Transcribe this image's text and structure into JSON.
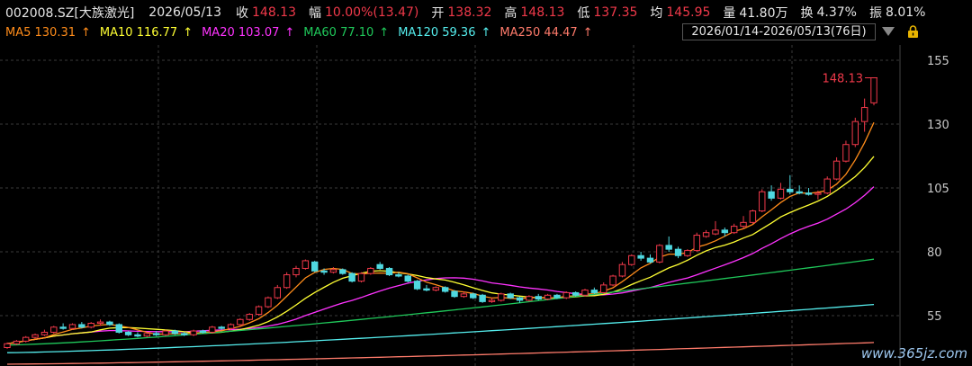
{
  "header": {
    "code": "002008.SZ[大族激光]",
    "date": "2026/05/13",
    "close_label": "收",
    "close": "148.13",
    "change_label": "幅",
    "change": "10.00%(13.47)",
    "open_label": "开",
    "open": "138.32",
    "high_label": "高",
    "high": "148.13",
    "low_label": "低",
    "low": "137.35",
    "avg_label": "均",
    "avg": "145.95",
    "volume_label": "量",
    "volume": "41.80万",
    "turnover_label": "换",
    "turnover": "4.37%",
    "amplitude_label": "振",
    "amplitude": "8.01%"
  },
  "ma_legend": [
    {
      "label": "MA5 130.31",
      "arrow": "↑",
      "color": "#ff8c1a"
    },
    {
      "label": "MA10 116.77",
      "arrow": "↑",
      "color": "#ffff33"
    },
    {
      "label": "MA20 103.07",
      "arrow": "↑",
      "color": "#ff33ff"
    },
    {
      "label": "MA60 77.10",
      "arrow": "↑",
      "color": "#1fc85a"
    },
    {
      "label": "MA120 59.36",
      "arrow": "↑",
      "color": "#55eeee"
    },
    {
      "label": "MA250 44.47",
      "arrow": "↑",
      "color": "#ff7b6b"
    }
  ],
  "range_label": "2026/01/14-2026/05/13(76日)",
  "watermark": "www.365jz.com",
  "colors": {
    "up": "#f0394a",
    "down": "#4fd8e0",
    "grid": "#3a3a3a"
  },
  "icons": [
    "dropdown-triangle-icon",
    "lock-icon"
  ],
  "chart_data": {
    "type": "candlestick",
    "yticks": [
      55,
      80,
      105,
      130,
      155
    ],
    "ylim": [
      45,
      160
    ],
    "last_price_label": "148.13",
    "candles": [
      [
        42.5,
        44.0,
        42.0,
        44.5
      ],
      [
        44.0,
        45.0,
        43.5,
        45.5
      ],
      [
        45.0,
        46.5,
        44.5,
        47.0
      ],
      [
        46.5,
        47.5,
        46.0,
        48.0
      ],
      [
        47.5,
        48.5,
        47.0,
        49.5
      ],
      [
        48.5,
        50.5,
        48.0,
        51.0
      ],
      [
        50.5,
        50.0,
        49.5,
        52.0
      ],
      [
        50.0,
        51.5,
        49.5,
        52.0
      ],
      [
        51.5,
        50.5,
        50.0,
        52.5
      ],
      [
        50.5,
        52.0,
        50.0,
        52.5
      ],
      [
        52.0,
        52.5,
        51.0,
        53.5
      ],
      [
        52.5,
        51.5,
        51.0,
        53.0
      ],
      [
        51.5,
        48.5,
        48.0,
        52.0
      ],
      [
        48.5,
        47.5,
        47.0,
        49.0
      ],
      [
        47.5,
        47.0,
        46.5,
        48.5
      ],
      [
        47.0,
        48.0,
        46.5,
        48.5
      ],
      [
        48.0,
        47.5,
        47.0,
        49.0
      ],
      [
        47.5,
        49.0,
        47.0,
        49.5
      ],
      [
        49.0,
        48.0,
        47.5,
        49.5
      ],
      [
        48.0,
        47.5,
        47.0,
        48.5
      ],
      [
        47.5,
        49.0,
        47.0,
        49.5
      ],
      [
        49.0,
        48.5,
        48.0,
        49.5
      ],
      [
        48.5,
        50.5,
        48.0,
        51.0
      ],
      [
        50.5,
        50.0,
        49.5,
        51.0
      ],
      [
        50.0,
        51.5,
        49.5,
        52.0
      ],
      [
        51.5,
        53.5,
        51.0,
        54.0
      ],
      [
        53.5,
        55.5,
        53.0,
        56.0
      ],
      [
        55.5,
        58.5,
        55.0,
        59.0
      ],
      [
        58.5,
        62.0,
        58.0,
        62.5
      ],
      [
        62.0,
        66.0,
        61.5,
        67.0
      ],
      [
        66.0,
        71.0,
        65.5,
        72.0
      ],
      [
        71.0,
        73.5,
        70.0,
        74.5
      ],
      [
        73.5,
        76.5,
        73.0,
        77.0
      ],
      [
        76.0,
        72.5,
        72.0,
        76.5
      ],
      [
        72.5,
        72.0,
        71.0,
        73.5
      ],
      [
        72.0,
        73.0,
        71.5,
        74.0
      ],
      [
        73.0,
        71.5,
        71.0,
        73.5
      ],
      [
        71.5,
        68.5,
        68.0,
        72.0
      ],
      [
        68.5,
        71.5,
        68.0,
        72.0
      ],
      [
        71.5,
        73.5,
        71.0,
        74.0
      ],
      [
        75.0,
        73.5,
        73.0,
        76.0
      ],
      [
        73.5,
        71.0,
        70.5,
        74.0
      ],
      [
        71.0,
        70.5,
        70.0,
        72.0
      ],
      [
        70.5,
        68.5,
        68.0,
        71.0
      ],
      [
        68.5,
        65.5,
        65.0,
        69.0
      ],
      [
        65.5,
        65.0,
        64.5,
        67.0
      ],
      [
        65.0,
        66.0,
        64.5,
        66.5
      ],
      [
        66.0,
        64.5,
        64.0,
        66.5
      ],
      [
        64.5,
        62.5,
        62.0,
        65.0
      ],
      [
        62.5,
        63.5,
        62.0,
        64.5
      ],
      [
        63.5,
        62.0,
        61.5,
        64.0
      ],
      [
        63.0,
        60.5,
        60.0,
        63.5
      ],
      [
        60.5,
        61.0,
        60.0,
        62.0
      ],
      [
        61.0,
        63.5,
        60.5,
        64.0
      ],
      [
        63.5,
        62.0,
        61.5,
        64.0
      ],
      [
        62.0,
        61.0,
        60.0,
        62.5
      ],
      [
        61.0,
        62.5,
        60.5,
        63.0
      ],
      [
        62.5,
        61.5,
        61.0,
        63.5
      ],
      [
        61.5,
        63.0,
        61.0,
        63.5
      ],
      [
        63.0,
        62.0,
        61.5,
        63.5
      ],
      [
        62.0,
        64.0,
        61.5,
        64.5
      ],
      [
        64.0,
        63.0,
        62.5,
        64.5
      ],
      [
        63.0,
        65.0,
        62.5,
        65.5
      ],
      [
        65.0,
        64.0,
        63.5,
        66.0
      ],
      [
        64.0,
        67.0,
        63.5,
        68.0
      ],
      [
        67.0,
        70.5,
        66.5,
        71.0
      ],
      [
        70.5,
        75.0,
        70.0,
        76.0
      ],
      [
        75.0,
        78.5,
        74.5,
        79.0
      ],
      [
        78.5,
        77.5,
        76.5,
        80.0
      ],
      [
        77.5,
        76.0,
        75.5,
        79.0
      ],
      [
        76.0,
        82.5,
        75.5,
        83.0
      ],
      [
        82.5,
        81.0,
        80.0,
        86.0
      ],
      [
        81.0,
        78.5,
        77.5,
        82.0
      ],
      [
        78.5,
        80.5,
        78.0,
        81.0
      ],
      [
        80.5,
        86.5,
        80.0,
        87.5
      ],
      [
        86.0,
        87.5,
        85.5,
        88.5
      ],
      [
        87.0,
        88.5,
        86.5,
        92.0
      ],
      [
        88.5,
        87.5,
        86.0,
        89.5
      ],
      [
        87.5,
        90.0,
        87.0,
        91.0
      ],
      [
        90.0,
        91.5,
        89.0,
        94.0
      ],
      [
        91.5,
        96.0,
        91.0,
        96.5
      ],
      [
        96.0,
        103.5,
        95.5,
        104.5
      ],
      [
        103.5,
        101.0,
        100.0,
        106.0
      ],
      [
        101.0,
        104.5,
        100.5,
        107.0
      ],
      [
        104.5,
        103.5,
        102.5,
        110.0
      ],
      [
        103.5,
        103.0,
        102.5,
        106.0
      ],
      [
        103.0,
        102.5,
        102.0,
        105.0
      ],
      [
        102.5,
        103.0,
        100.5,
        104.0
      ],
      [
        103.0,
        108.5,
        102.5,
        109.5
      ],
      [
        108.5,
        115.5,
        108.0,
        117.0
      ],
      [
        115.5,
        122.0,
        115.0,
        123.5
      ],
      [
        122.0,
        131.0,
        121.0,
        132.5
      ],
      [
        131.0,
        136.5,
        127.0,
        140.0
      ],
      [
        138.32,
        148.13,
        137.35,
        148.13
      ]
    ]
  }
}
